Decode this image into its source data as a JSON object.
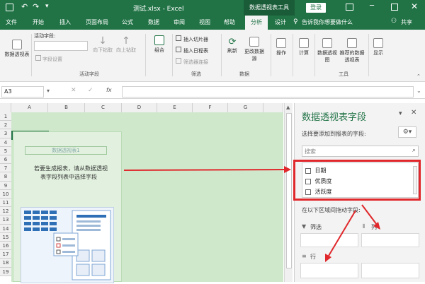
{
  "titlebar": {
    "title": "测试.xlsx - Excel",
    "context_tab": "数据透视表工具",
    "login_label": "登录"
  },
  "menu": {
    "items": [
      "文件",
      "开始",
      "插入",
      "页面布局",
      "公式",
      "数据",
      "审阅",
      "视图",
      "帮助",
      "分析",
      "设计"
    ],
    "active_index": 9,
    "tell_me": "告诉我你想要做什么",
    "share": "共享"
  },
  "ribbon": {
    "pivot_table": "数据透视表",
    "active_field_label": "活动字段:",
    "field_settings": "字段设置",
    "drill_down": "向下钻取",
    "drill_up": "向上钻取",
    "group_active_field": "活动字段",
    "group": "组合",
    "insert_slicer": "插入切片器",
    "insert_timeline": "插入日程表",
    "filter_connections": "筛选器连接",
    "group_filter": "筛选",
    "refresh": "刷新",
    "change_source": "更改数据源",
    "group_data": "数据",
    "actions": "操作",
    "calculations": "计算",
    "pivot_chart": "数据透视图",
    "recommended": "推荐的数据透视表",
    "group_tools": "工具",
    "show": "显示"
  },
  "formula": {
    "name_box": "A3",
    "fx": "fx"
  },
  "grid": {
    "columns": [
      "A",
      "B",
      "C",
      "D",
      "E",
      "F",
      "G"
    ],
    "rows": [
      "1",
      "2",
      "3",
      "4",
      "5",
      "6",
      "7",
      "8",
      "9",
      "10",
      "11",
      "12",
      "13",
      "14",
      "15",
      "16",
      "17",
      "18",
      "19"
    ],
    "pivot_name": "数据透视表1",
    "instruction_line1": "若要生成报表，请从数据透视",
    "instruction_line2": "表字段列表中选择字段"
  },
  "pane": {
    "title": "数据透视表字段",
    "subtitle": "选择要添加到报表的字段:",
    "search_placeholder": "搜索",
    "fields": [
      "日期",
      "优质度",
      "活跃度"
    ],
    "drag_label": "在以下区域间拖动字段:",
    "area_filter": "筛选",
    "area_columns": "列",
    "area_rows": "行"
  },
  "colors": {
    "excel_green": "#217346",
    "annotation_red": "#e0282c",
    "pivot_area": "#cfe8cc"
  }
}
